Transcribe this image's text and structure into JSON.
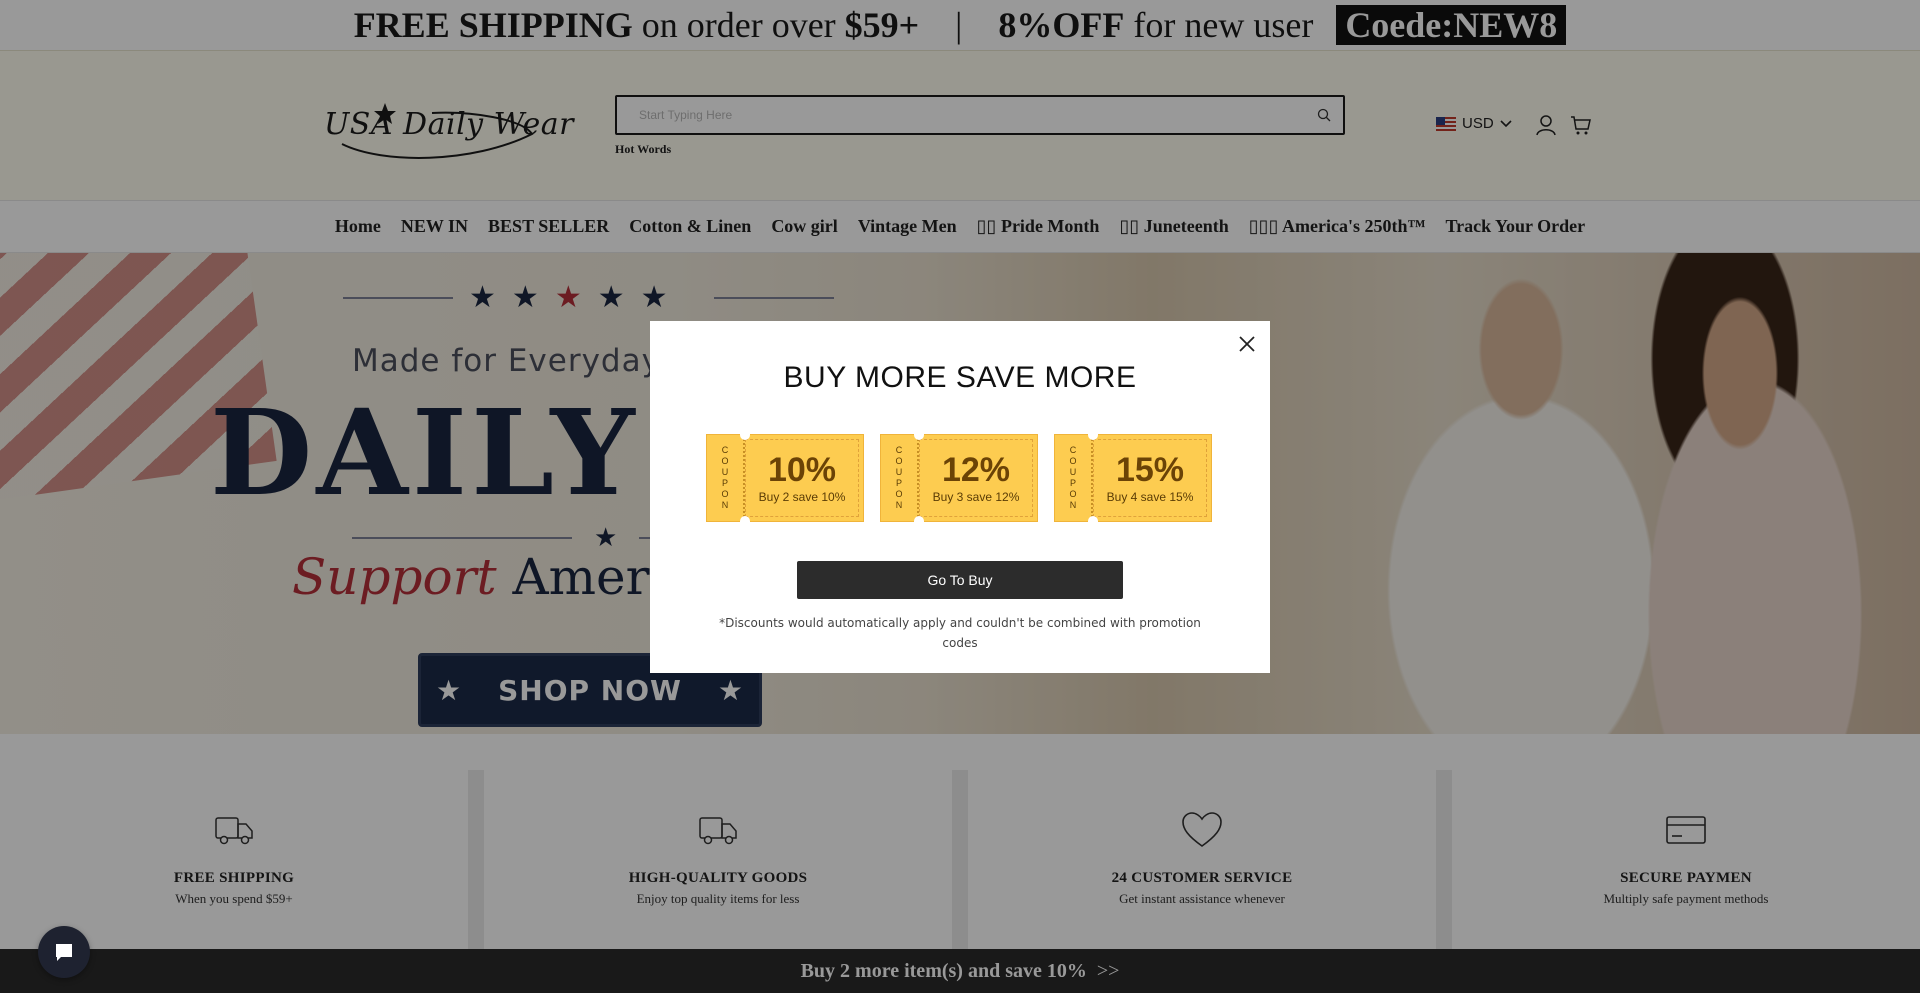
{
  "promo": {
    "free_shipping_bold": "FREE SHIPPING",
    "free_shipping_text": " on order over ",
    "free_shipping_amount": "$59+",
    "separator": "|",
    "discount_bold": "8%OFF",
    "discount_text": " for new user ",
    "code": "Coede:NEW8"
  },
  "header": {
    "logo_text": "USA Daily Wear",
    "search_placeholder": "Start Typing Here",
    "hot_words": "Hot Words",
    "currency": "USD"
  },
  "nav": {
    "items": [
      "Home",
      "NEW IN",
      "BEST SELLER",
      "Cotton & Linen",
      "Cow girl",
      "Vintage Men",
      "🏳️‍🌈 Pride Month",
      "🌴 Juneteenth",
      "🇺🇸 America's 250th™",
      "Track Your Order"
    ],
    "rendered": [
      "Home",
      "NEW IN",
      "BEST SELLER",
      "Cotton & Linen",
      "Cow girl",
      "Vintage Men",
      "▯▯ Pride Month",
      "▯▯ Juneteenth",
      "▯▯▯ America's 250th™",
      "Track Your Order"
    ]
  },
  "hero": {
    "tagline": "Made for Everyday",
    "headline": "DAILY W",
    "support": "Support",
    "support_rest": " America",
    "shop_now": "SHOP NOW"
  },
  "features": [
    {
      "icon": "truck-icon",
      "title": "FREE SHIPPING",
      "subtitle": "When you spend $59+"
    },
    {
      "icon": "truck-icon",
      "title": "HIGH-QUALITY GOODS",
      "subtitle": "Enjoy top quality items for less"
    },
    {
      "icon": "heart-icon",
      "title": "24 CUSTOMER SERVICE",
      "subtitle": "Get instant assistance whenever"
    },
    {
      "icon": "credit-card-icon",
      "title": "SECURE PAYMEN",
      "subtitle": "Multiply safe payment methods"
    }
  ],
  "bottom_bar": {
    "text": "Buy 2 more item(s) and save 10%",
    "arrows": ">>"
  },
  "modal": {
    "title": "BUY MORE SAVE MORE",
    "coupon_label": [
      "C",
      "O",
      "U",
      "P",
      "O",
      "N"
    ],
    "coupons": [
      {
        "percent": "10%",
        "desc": "Buy 2 save 10%"
      },
      {
        "percent": "12%",
        "desc": "Buy 3 save 12%"
      },
      {
        "percent": "15%",
        "desc": "Buy 4 save 15%"
      }
    ],
    "button": "Go To Buy",
    "note": "*Discounts would automatically apply and couldn't be combined with promotion codes"
  },
  "colors": {
    "accent_dark": "#2c2c2c",
    "coupon_yellow": "#fdcc50",
    "coupon_text": "#6b4306",
    "hero_navy": "#1a2640",
    "hero_red": "#b5303a"
  }
}
